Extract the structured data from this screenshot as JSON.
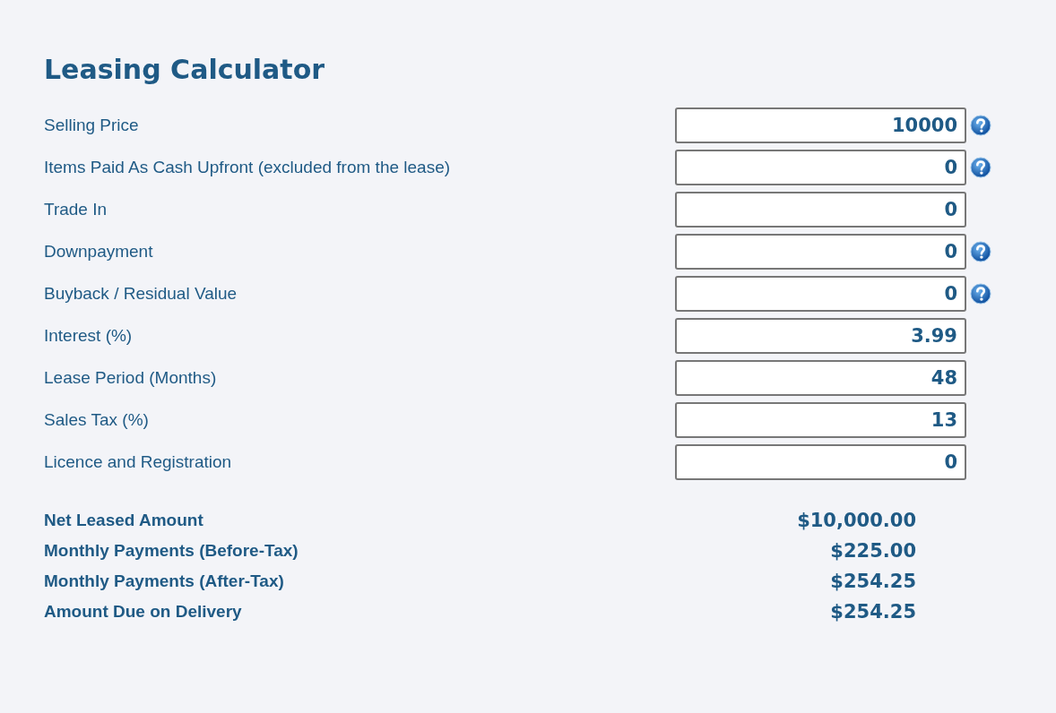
{
  "title": "Leasing Calculator",
  "fields": [
    {
      "label": "Selling Price",
      "value": "10000",
      "help": true
    },
    {
      "label": "Items Paid As Cash Upfront (excluded from the lease)",
      "value": "0",
      "help": true
    },
    {
      "label": "Trade In",
      "value": "0",
      "help": false
    },
    {
      "label": "Downpayment",
      "value": "0",
      "help": true
    },
    {
      "label": "Buyback / Residual Value",
      "value": "0",
      "help": true
    },
    {
      "label": "Interest (%)",
      "value": "3.99",
      "help": false
    },
    {
      "label": "Lease Period (Months)",
      "value": "48",
      "help": false
    },
    {
      "label": "Sales Tax (%)",
      "value": "13",
      "help": false
    },
    {
      "label": "Licence and Registration",
      "value": "0",
      "help": false
    }
  ],
  "results": [
    {
      "label": "Net Leased Amount",
      "value": "$10,000.00"
    },
    {
      "label": "Monthly Payments (Before-Tax)",
      "value": "$225.00"
    },
    {
      "label": "Monthly Payments (After-Tax)",
      "value": "$254.25"
    },
    {
      "label": "Amount Due on Delivery",
      "value": "$254.25"
    }
  ]
}
